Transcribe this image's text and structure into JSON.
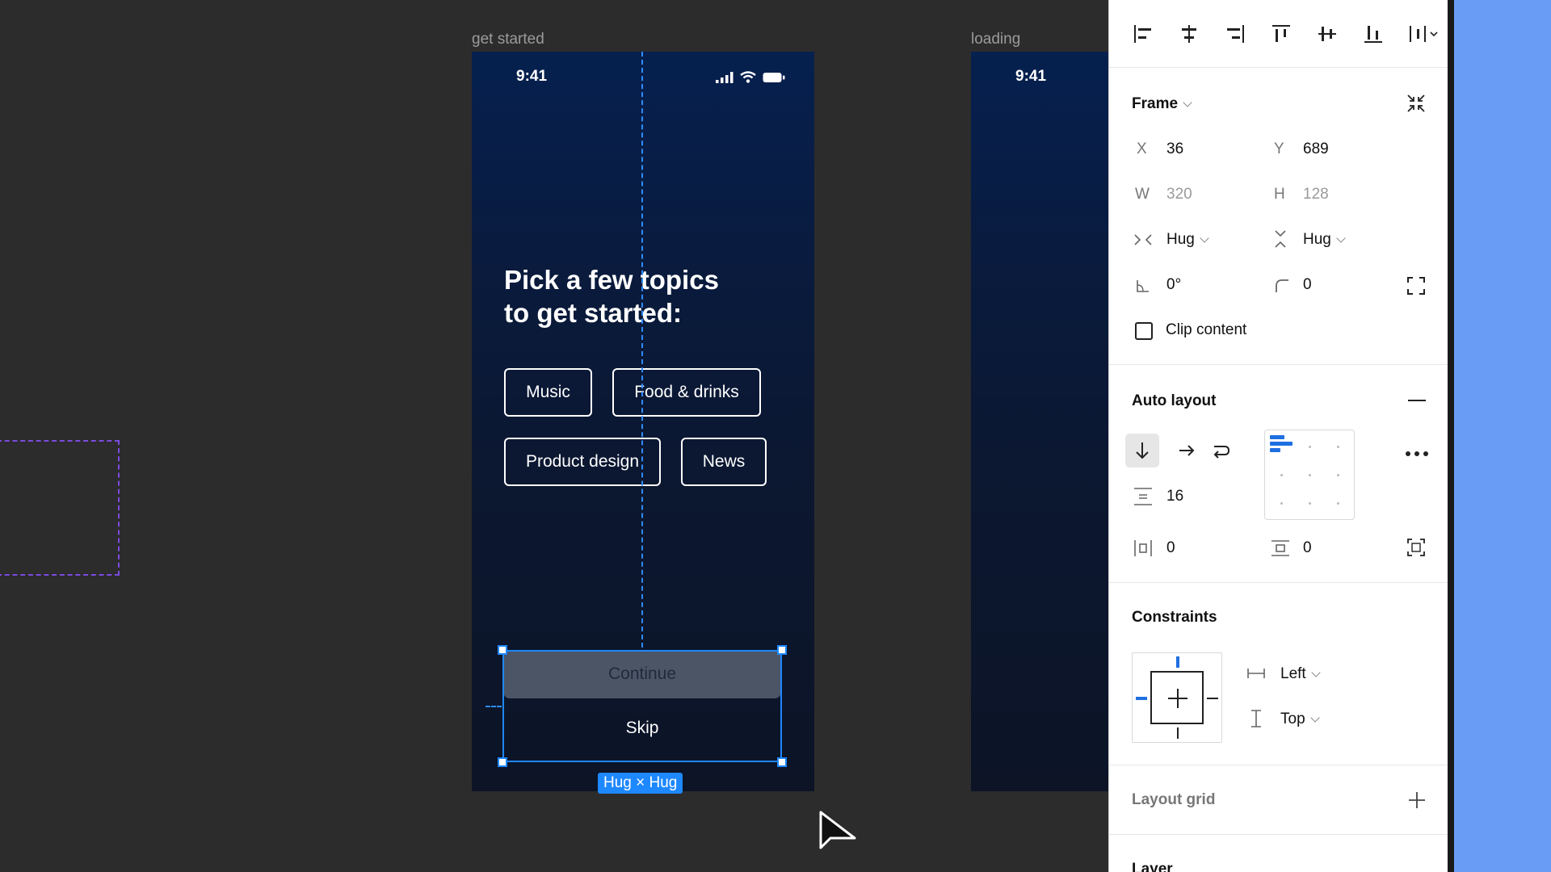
{
  "canvas": {
    "frames": [
      {
        "label": "get started",
        "status_time": "9:41",
        "headline_line1": "Pick a few topics",
        "headline_line2": "to get started:",
        "chips": [
          "Music",
          "Food & drinks",
          "Product design",
          "News"
        ],
        "primary_button": "Continue",
        "secondary_button": "Skip",
        "size_tag": "Hug × Hug"
      },
      {
        "label": "loading",
        "status_time": "9:41"
      }
    ]
  },
  "panel": {
    "frame": {
      "title": "Frame",
      "x_label": "X",
      "x_value": "36",
      "y_label": "Y",
      "y_value": "689",
      "w_label": "W",
      "w_value": "320",
      "h_label": "H",
      "h_value": "128",
      "horizontal_resizing": "Hug",
      "vertical_resizing": "Hug",
      "rotation": "0°",
      "corner_radius": "0",
      "clip_content_label": "Clip content"
    },
    "auto_layout": {
      "title": "Auto layout",
      "spacing": "16",
      "horizontal_padding": "0",
      "vertical_padding": "0"
    },
    "constraints": {
      "title": "Constraints",
      "horizontal": "Left",
      "vertical": "Top"
    },
    "layout_grid": {
      "title": "Layout grid"
    },
    "layer": {
      "title": "Layer"
    }
  },
  "colors": {
    "accent": "#1e88ff",
    "side_panel": "#699df5",
    "canvas": "#2c2c2c"
  }
}
